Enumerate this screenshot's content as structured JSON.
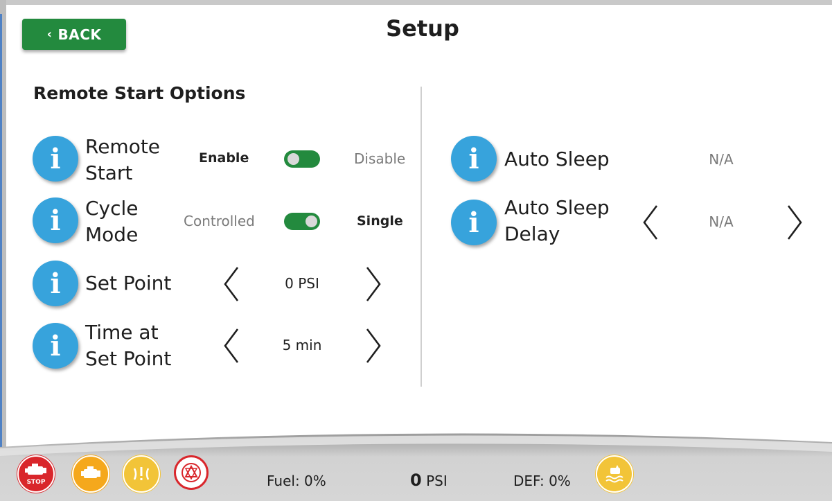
{
  "header": {
    "back_label": "BACK",
    "back_chevron": "‹",
    "title": "Setup"
  },
  "section": {
    "title": "Remote Start Options"
  },
  "left_rows": {
    "remote_start": {
      "label_line1": "Remote",
      "label_line2": "Start",
      "option_left": "Enable",
      "option_right": "Disable",
      "selected": "Enable"
    },
    "cycle_mode": {
      "label_line1": "Cycle",
      "label_line2": "Mode",
      "option_left": "Controlled",
      "option_right": "Single",
      "selected": "Single"
    },
    "set_point": {
      "label": "Set Point",
      "value": "0 PSI"
    },
    "time_at_set_point": {
      "label_line1": "Time at",
      "label_line2": "Set Point",
      "value": "5 min"
    }
  },
  "right_rows": {
    "auto_sleep": {
      "label": "Auto Sleep",
      "value": "N/A"
    },
    "auto_sleep_delay": {
      "label_line1": "Auto Sleep",
      "label_line2": "Delay",
      "value": "N/A"
    }
  },
  "info_glyph": "i",
  "status_bar": {
    "stop_label": "STOP",
    "fuel": "Fuel: 0%",
    "pressure_value": "0",
    "pressure_unit": "PSI",
    "def": "DEF: 0%",
    "icons": [
      "engine-stop-icon",
      "check-engine-icon",
      "glow-plug-icon",
      "regen-warning-icon",
      "coolant-level-icon"
    ]
  },
  "colors": {
    "accent_green": "#238a3e",
    "info_blue": "#37a3dc",
    "stop_red": "#d9262b",
    "warn_orange": "#f5a81c",
    "caution_yellow": "#f2c438"
  }
}
